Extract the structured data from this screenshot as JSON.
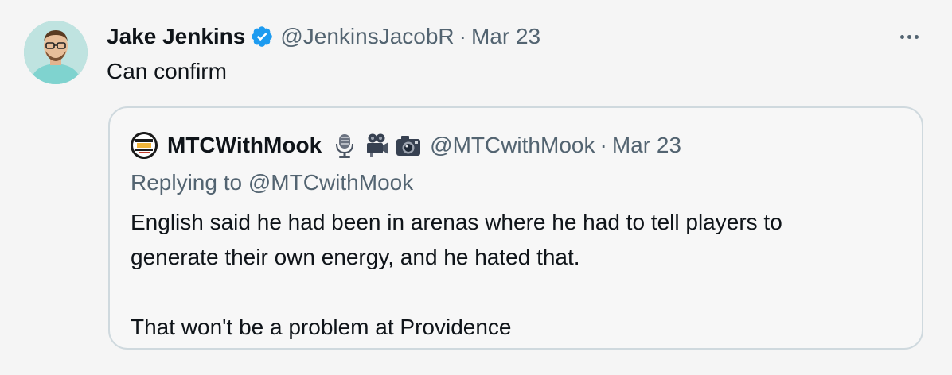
{
  "tweet": {
    "author_name": "Jake Jenkins",
    "author_handle": "@JenkinsJacobR",
    "separator": "·",
    "date": "Mar 23",
    "text": "Can confirm",
    "more_icon": "more-horizontal-icon",
    "verified_icon": "verified-badge-icon"
  },
  "quote": {
    "author_name": "MTCWithMook",
    "name_emojis": [
      "microphone-icon",
      "movie-camera-icon",
      "camera-icon"
    ],
    "author_handle": "@MTCwithMook",
    "separator": "·",
    "date": "Mar 23",
    "replying_prefix": "Replying to",
    "replying_handle": "@MTCwithMook",
    "lines": [
      "English said he had been in arenas where he had to tell players to",
      "generate their own energy, and he hated that.",
      "",
      "That won't be a problem at Providence"
    ]
  },
  "colors": {
    "background": "#f5f5f5",
    "verified_blue": "#1d9bf0",
    "secondary_text": "#536471",
    "border": "#cfd9de"
  }
}
